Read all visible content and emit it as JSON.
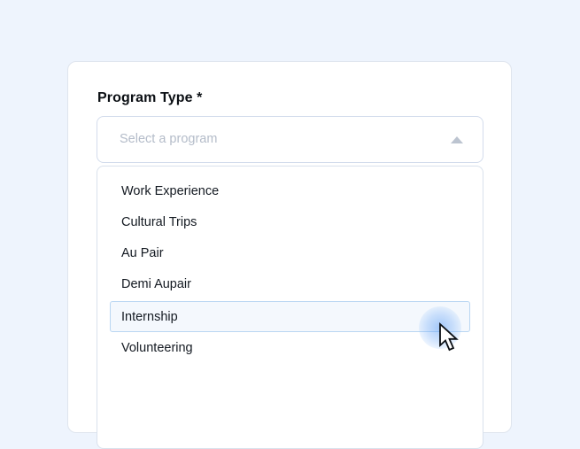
{
  "form": {
    "field_label": "Program Type *",
    "select": {
      "placeholder": "Select a program",
      "expanded": true,
      "caret_icon": "chevron-up-icon"
    },
    "options": [
      {
        "label": "Work Experience",
        "highlighted": false
      },
      {
        "label": "Cultural Trips",
        "highlighted": false
      },
      {
        "label": "Au Pair",
        "highlighted": false
      },
      {
        "label": "Demi Aupair",
        "highlighted": false
      },
      {
        "label": "Internship",
        "highlighted": true
      },
      {
        "label": "Volunteering",
        "highlighted": false
      }
    ]
  },
  "colors": {
    "page_background": "#eef4fd",
    "highlight_background": "#f4f8fd",
    "highlight_border": "#b9d6f2",
    "placeholder_text": "#b4bcc9"
  },
  "cursor": {
    "icon": "mouse-pointer-icon",
    "click_indicator": "click-ripple"
  }
}
